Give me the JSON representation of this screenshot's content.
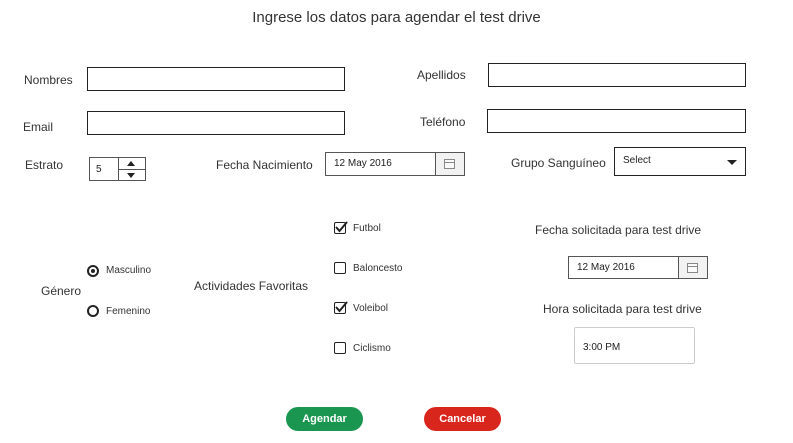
{
  "title": "Ingrese los datos para agendar el test drive",
  "fields": {
    "nombres": {
      "label": "Nombres",
      "value": ""
    },
    "apellidos": {
      "label": "Apellidos",
      "value": ""
    },
    "email": {
      "label": "Email",
      "value": ""
    },
    "telefono": {
      "label": "Teléfono",
      "value": ""
    },
    "estrato": {
      "label": "Estrato",
      "value": "5"
    },
    "fecha_nacimiento": {
      "label": "Fecha Nacimiento",
      "value": "12 May 2016"
    },
    "grupo_sanguineo": {
      "label": "Grupo Sanguíneo",
      "value": "Select"
    }
  },
  "genero": {
    "label": "Género",
    "options": [
      {
        "label": "Masculino",
        "selected": true
      },
      {
        "label": "Femenino",
        "selected": false
      }
    ]
  },
  "actividades": {
    "label": "Actividades Favoritas",
    "options": [
      {
        "label": "Futbol",
        "checked": true
      },
      {
        "label": "Baloncesto",
        "checked": false
      },
      {
        "label": "Voleibol",
        "checked": true
      },
      {
        "label": "Ciclismo",
        "checked": false
      }
    ]
  },
  "test_drive": {
    "fecha_label": "Fecha solicitada para test drive",
    "fecha_value": "12 May 2016",
    "hora_label": "Hora solicitada para test drive",
    "hora_value": "3:00 PM"
  },
  "buttons": {
    "agendar": {
      "label": "Agendar",
      "color": "#1a9650"
    },
    "cancelar": {
      "label": "Cancelar",
      "color": "#d9261c"
    }
  },
  "icons": {
    "calendar": "calendar-icon",
    "caret": "chevron-down-icon"
  }
}
